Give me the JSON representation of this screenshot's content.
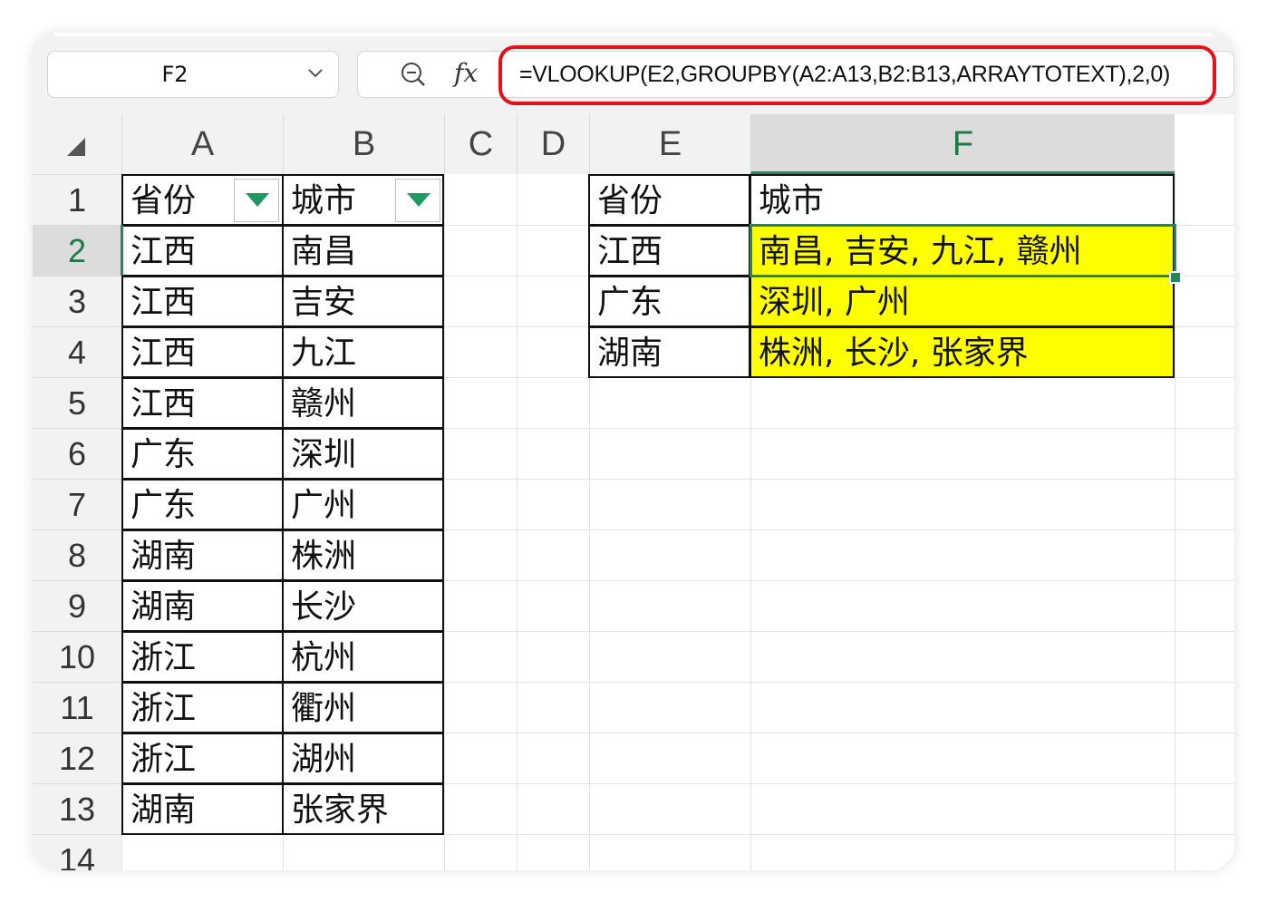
{
  "namebox": {
    "ref": "F2"
  },
  "formula": {
    "fx": "fx",
    "text": "=VLOOKUP(E2,GROUPBY(A2:A13,B2:B13,ARRAYTOTEXT),2,0)"
  },
  "columns": [
    "A",
    "B",
    "C",
    "D",
    "E",
    "F"
  ],
  "rows": [
    "1",
    "2",
    "3",
    "4",
    "5",
    "6",
    "7",
    "8",
    "9",
    "10",
    "11",
    "12",
    "13",
    "14"
  ],
  "selected_column": "F",
  "selected_row": "2",
  "source_table": {
    "header": [
      "省份",
      "城市"
    ],
    "rows": [
      [
        "江西",
        "南昌"
      ],
      [
        "江西",
        "吉安"
      ],
      [
        "江西",
        "九江"
      ],
      [
        "江西",
        "赣州"
      ],
      [
        "广东",
        "深圳"
      ],
      [
        "广东",
        "广州"
      ],
      [
        "湖南",
        "株洲"
      ],
      [
        "湖南",
        "长沙"
      ],
      [
        "浙江",
        "杭州"
      ],
      [
        "浙江",
        "衢州"
      ],
      [
        "浙江",
        "湖州"
      ],
      [
        "湖南",
        "张家界"
      ]
    ]
  },
  "result_table": {
    "header": [
      "省份",
      "城市"
    ],
    "rows": [
      [
        "江西",
        "南昌, 吉安, 九江, 赣州"
      ],
      [
        "广东",
        "深圳, 广州"
      ],
      [
        "湖南",
        "株洲, 长沙, 张家界"
      ]
    ]
  },
  "colors": {
    "accent": "#1f8a58",
    "highlight": "#ffff00",
    "callout": "#e3131b"
  }
}
